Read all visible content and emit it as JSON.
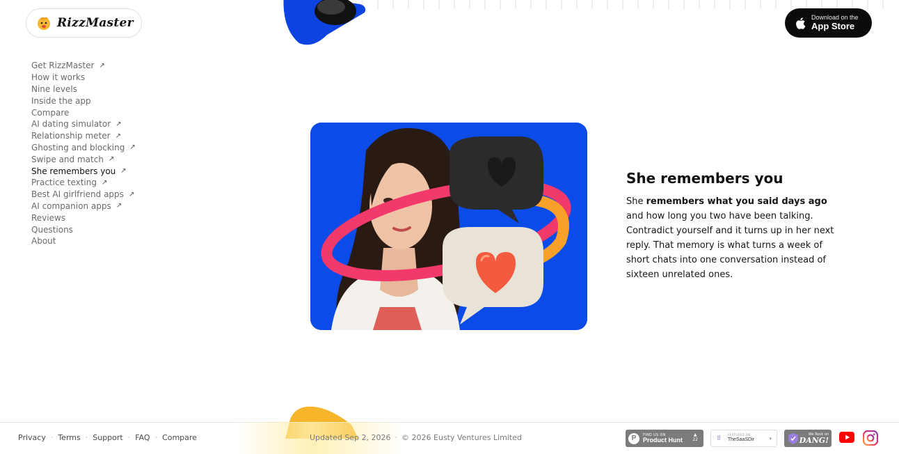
{
  "brand": {
    "name": "RizzMaster"
  },
  "appstore": {
    "small": "Download on the",
    "big": "App Store"
  },
  "sidenav": {
    "items": [
      {
        "label": "Get RizzMaster",
        "external": "↗"
      },
      {
        "label": "How it works"
      },
      {
        "label": "Nine levels"
      },
      {
        "label": "Inside the app"
      },
      {
        "label": "Compare"
      },
      {
        "label": "AI dating simulator",
        "external": "↗"
      },
      {
        "label": "Relationship meter",
        "external": "↗"
      },
      {
        "label": "Ghosting and blocking",
        "external": "↗"
      },
      {
        "label": "Swipe and match",
        "external": "↗"
      },
      {
        "label": "She remembers you",
        "external": "↗",
        "active": true
      },
      {
        "label": "Practice texting",
        "external": "↗"
      },
      {
        "label": "Best AI girlfriend apps",
        "external": "↗"
      },
      {
        "label": "AI companion apps",
        "external": "↗"
      },
      {
        "label": "Reviews"
      },
      {
        "label": "Questions"
      },
      {
        "label": "About"
      }
    ]
  },
  "section": {
    "title": "She remembers you",
    "body_pre": "She ",
    "body_bold": "remembers what you said days ago",
    "body_post": " and how long you two have been talking. Contradict yourself and it turns up in her next reply. That memory is what turns a week of short chats into one conversation instead of sixteen unrelated ones."
  },
  "footer": {
    "links": [
      "Privacy",
      "Terms",
      "Support",
      "FAQ",
      "Compare"
    ],
    "updated": "Updated Sep 2, 2026",
    "copyright": "© 2026 Eusty Ventures Limited",
    "badges": {
      "producthunt": {
        "small": "FIND US ON",
        "big": "Product Hunt",
        "votes": "22"
      },
      "saasdir": {
        "small": "FEATURED ON",
        "big": "TheSaaSDir"
      },
      "dang": {
        "small": "We Rock on",
        "big": "DANG!"
      }
    }
  },
  "colors": {
    "hero_bg": "#0b4be8",
    "accent_yellow": "#f7b52a",
    "dark": "#0b0b0b"
  }
}
